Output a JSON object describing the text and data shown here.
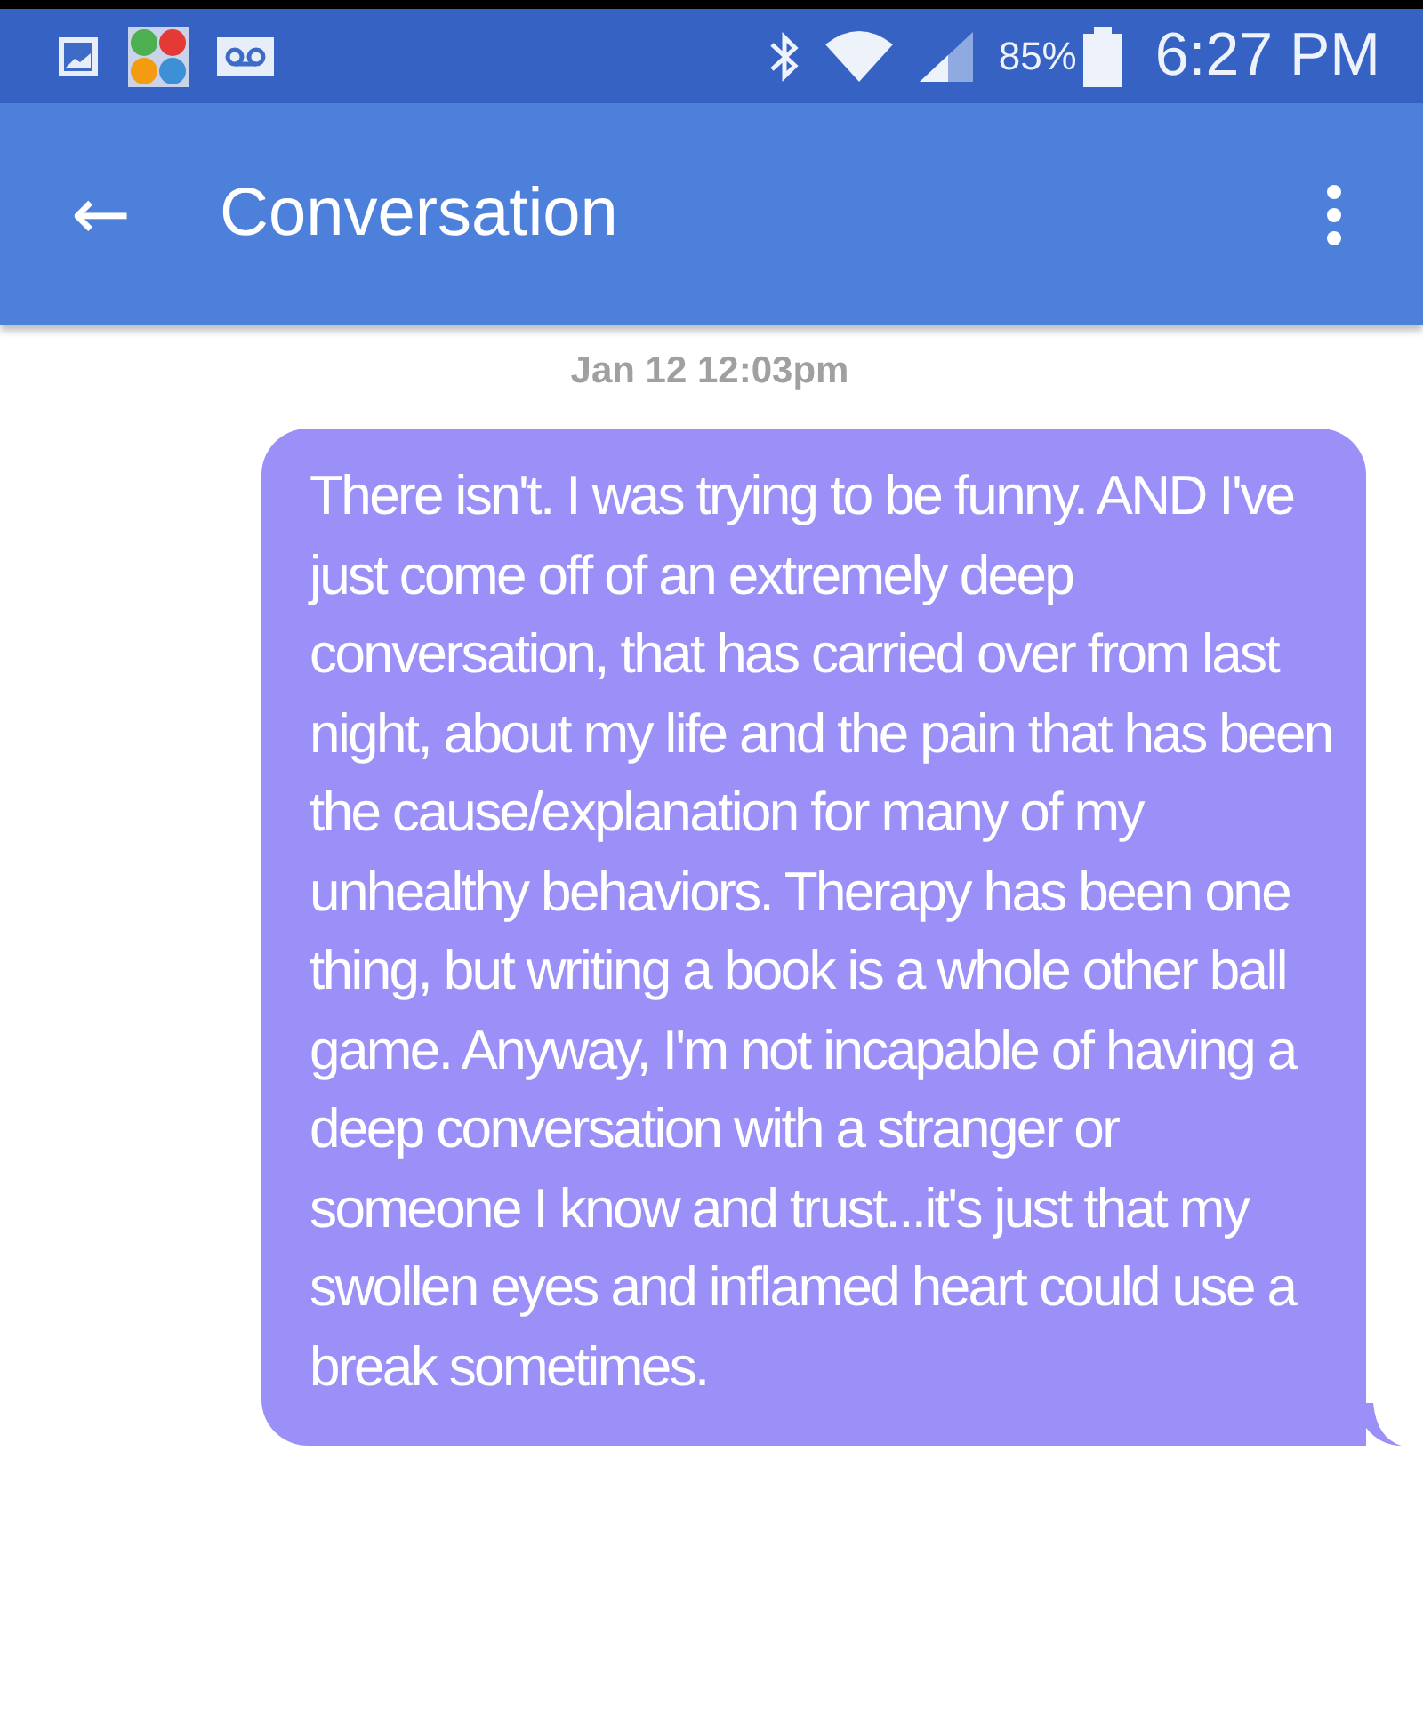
{
  "status_bar": {
    "battery": "85%",
    "time": "6:27 PM"
  },
  "app_bar": {
    "back": "←",
    "title": "Conversation"
  },
  "messages": [
    {
      "kind": "sent",
      "timestamp": "Jan 12 12:03pm",
      "text": "There isn't. I was trying to be funny. AND I've just come off of an extremely deep conversation, that has carried over from last night, about my life and the pain that has been the cause/explanation for many of my unhealthy behaviors. Therapy has been one thing, but writing a book is a whole other ball game. Anyway, I'm not incapable of having a deep conversation with a stranger or someone I know and trust...it's just that my swollen eyes and inflamed heart could use a break sometimes."
    }
  ]
}
